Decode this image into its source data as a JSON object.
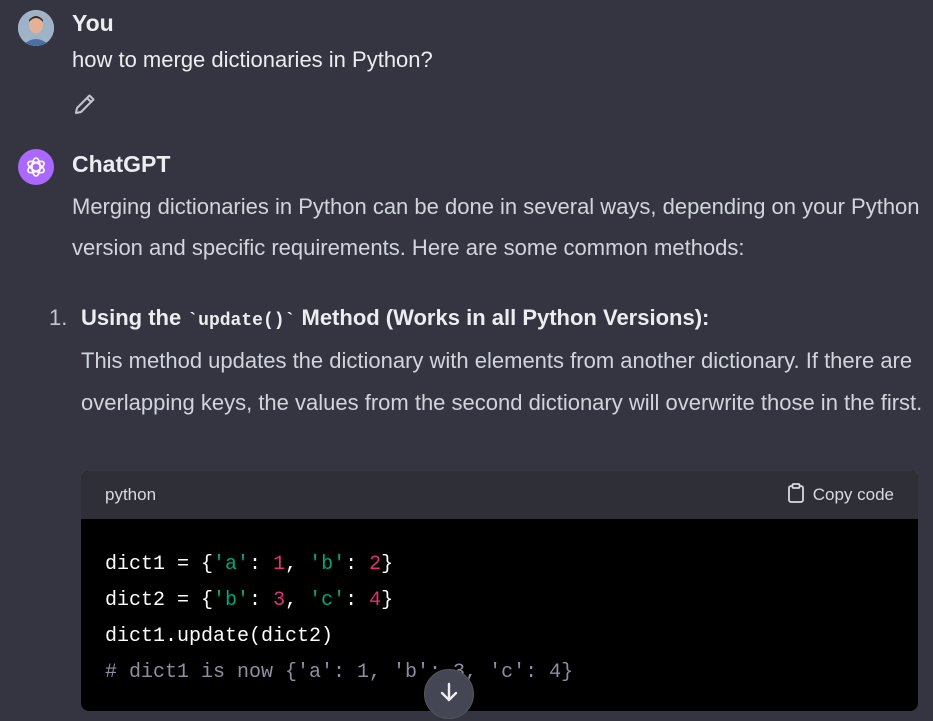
{
  "user": {
    "name": "You",
    "message": "how to merge dictionaries in Python?"
  },
  "assistant": {
    "name": "ChatGPT",
    "intro": "Merging dictionaries in Python can be done in several ways, depending on your Python version and specific requirements. Here are some common methods:",
    "list": [
      {
        "number": "1.",
        "heading_pre": "Using the ",
        "heading_code": "`update()`",
        "heading_post": " Method (Works in all Python Versions):",
        "description": "This method updates the dictionary with elements from another dictionary. If there are overlapping keys, the values from the second dictionary will overwrite those in the first."
      }
    ]
  },
  "code_block": {
    "language": "python",
    "copy_label": "Copy code",
    "lines": [
      [
        {
          "t": "dict1 = {",
          "c": "plain"
        },
        {
          "t": "'a'",
          "c": "str"
        },
        {
          "t": ": ",
          "c": "plain"
        },
        {
          "t": "1",
          "c": "num"
        },
        {
          "t": ", ",
          "c": "plain"
        },
        {
          "t": "'b'",
          "c": "str"
        },
        {
          "t": ": ",
          "c": "plain"
        },
        {
          "t": "2",
          "c": "num"
        },
        {
          "t": "}",
          "c": "plain"
        }
      ],
      [
        {
          "t": "dict2 = {",
          "c": "plain"
        },
        {
          "t": "'b'",
          "c": "str"
        },
        {
          "t": ": ",
          "c": "plain"
        },
        {
          "t": "3",
          "c": "num"
        },
        {
          "t": ", ",
          "c": "plain"
        },
        {
          "t": "'c'",
          "c": "str"
        },
        {
          "t": ": ",
          "c": "plain"
        },
        {
          "t": "4",
          "c": "num"
        },
        {
          "t": "}",
          "c": "plain"
        }
      ],
      [
        {
          "t": "dict1.update(dict2)",
          "c": "plain"
        }
      ],
      [
        {
          "t": "# dict1 is now {'a': 1, 'b': 3, 'c': 4}",
          "c": "cmt"
        }
      ]
    ]
  },
  "icons": {
    "edit": "pencil-icon",
    "assistant_logo": "openai-logo-icon",
    "copy": "clipboard-icon",
    "scroll_down": "arrow-down-icon"
  },
  "colors": {
    "background": "#343541",
    "assistant_avatar": "#ab68ff",
    "code_string": "#00a67d",
    "code_number": "#df3079"
  }
}
